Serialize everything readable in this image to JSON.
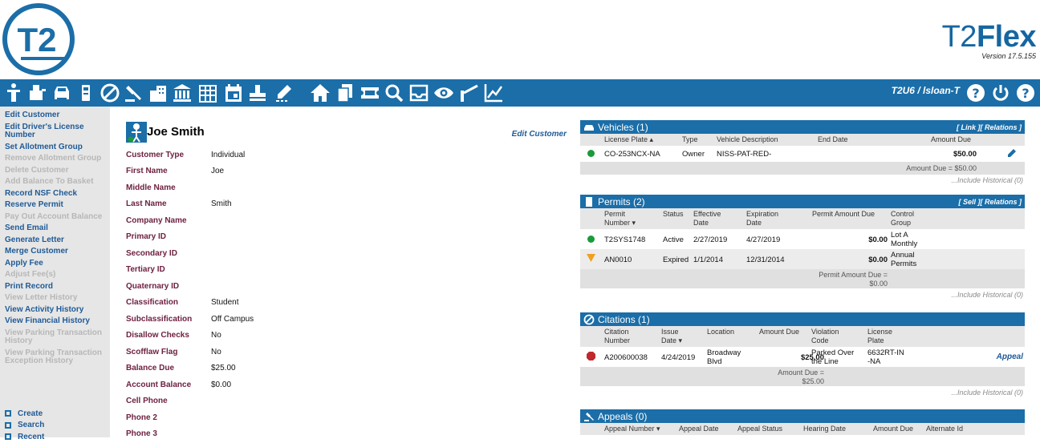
{
  "brand": {
    "name_light": "T2",
    "name_bold": "Flex",
    "version": "Version 17.5.155",
    "logo_text": "T2"
  },
  "toolbar": {
    "user": "T2U6 / lsloan-T",
    "icons": [
      "person-icon",
      "cart-icon",
      "car-icon",
      "permit-icon",
      "ban-icon",
      "gavel-icon",
      "buildings-icon",
      "bank-icon",
      "grid-building-icon",
      "calendar-icon",
      "stamp-icon",
      "pencil-icon",
      "home-icon",
      "copy-icon",
      "ticket-icon",
      "search-icon",
      "inbox-icon",
      "eye-icon",
      "gate-icon",
      "chart-icon"
    ],
    "right_icons": [
      "help-icon",
      "power-icon",
      "question-icon"
    ]
  },
  "sidebar": {
    "items": [
      {
        "label": "Edit Customer",
        "enabled": true
      },
      {
        "label": "Edit Driver's License Number",
        "enabled": true
      },
      {
        "label": "Set Allotment Group",
        "enabled": true
      },
      {
        "label": "Remove Allotment Group",
        "enabled": false
      },
      {
        "label": "Delete Customer",
        "enabled": false
      },
      {
        "label": "Add Balance To Basket",
        "enabled": false
      },
      {
        "label": "Record NSF Check",
        "enabled": true
      },
      {
        "label": "Reserve Permit",
        "enabled": true
      },
      {
        "label": "Pay Out Account Balance",
        "enabled": false
      },
      {
        "label": "Send Email",
        "enabled": true
      },
      {
        "label": "Generate Letter",
        "enabled": true
      },
      {
        "label": "Merge Customer",
        "enabled": true
      },
      {
        "label": "Apply Fee",
        "enabled": true
      },
      {
        "label": "Adjust Fee(s)",
        "enabled": false
      },
      {
        "label": "Print Record",
        "enabled": true
      },
      {
        "label": "View Letter History",
        "enabled": false
      },
      {
        "label": "View Activity History",
        "enabled": true
      },
      {
        "label": "View Financial History",
        "enabled": true
      },
      {
        "label": "View Parking Transaction History",
        "enabled": false
      },
      {
        "label": "View Parking Transaction Exception History",
        "enabled": false
      }
    ],
    "bottom": [
      "Create",
      "Search",
      "Recent"
    ]
  },
  "customer": {
    "name": "Joe Smith",
    "edit_label": "Edit Customer",
    "fields": [
      {
        "label": "Customer Type",
        "value": "Individual"
      },
      {
        "label": "First Name",
        "value": "Joe"
      },
      {
        "label": "Middle Name",
        "value": ""
      },
      {
        "label": "Last Name",
        "value": "Smith"
      },
      {
        "label": "Company Name",
        "value": ""
      },
      {
        "label": "Primary ID",
        "value": ""
      },
      {
        "label": "Secondary ID",
        "value": ""
      },
      {
        "label": "Tertiary ID",
        "value": ""
      },
      {
        "label": "Quaternary ID",
        "value": ""
      },
      {
        "label": "Classification",
        "value": "Student"
      },
      {
        "label": "Subclassification",
        "value": "Off Campus"
      },
      {
        "label": "Disallow Checks",
        "value": "No"
      },
      {
        "label": "Scofflaw Flag",
        "value": "No"
      },
      {
        "label": "Balance Due",
        "value": "$25.00"
      },
      {
        "label": "Account Balance",
        "value": "$0.00"
      },
      {
        "label": "Cell Phone",
        "value": ""
      },
      {
        "label": "Phone 2",
        "value": ""
      },
      {
        "label": "Phone 3",
        "value": ""
      }
    ]
  },
  "vehicles": {
    "title": "Vehicles (1)",
    "links": "[ Link ][ Relations ]",
    "headers": {
      "plate": "License Plate",
      "type": "Type",
      "desc": "Vehicle Description",
      "end": "End Date",
      "amount": "Amount Due"
    },
    "row": {
      "plate": "CO-253NCX-NA",
      "type": "Owner",
      "desc": "NISS-PAT-RED-",
      "end": "",
      "amount": "$50.00",
      "status_color": "#1a9a3a"
    },
    "summary": "Amount Due = $50.00",
    "historical": "...Include Historical (0)"
  },
  "permits": {
    "title": "Permits (2)",
    "links": "[ Sell ][ Relations ]",
    "headers": {
      "number": "Permit Number",
      "status": "Status",
      "effective": "Effective Date",
      "expiration": "Expiration Date",
      "amount": "Permit Amount Due",
      "group": "Control Group"
    },
    "rows": [
      {
        "number": "T2SYS1748",
        "status": "Active",
        "effective": "2/27/2019",
        "expiration": "4/27/2019",
        "amount": "$0.00",
        "group": "Lot A Monthly"
      },
      {
        "number": "AN0010",
        "status": "Expired",
        "effective": "1/1/2014",
        "expiration": "12/31/2014",
        "amount": "$0.00",
        "group": "Annual Permits"
      }
    ],
    "summary": "Permit Amount Due = $0.00",
    "historical": "...Include Historical (0)"
  },
  "citations": {
    "title": "Citations (1)",
    "headers": {
      "number": "Citation Number",
      "issue": "Issue Date",
      "location": "Location",
      "amount": "Amount Due",
      "violation": "Violation Code",
      "plate": "License Plate"
    },
    "row": {
      "number": "A200600038",
      "issue": "4/24/2019",
      "location": "Broadway Blvd",
      "amount": "$25.00",
      "violation": "Parked Over the Line",
      "plate": "6632RT-IN-NA",
      "action": "Appeal"
    },
    "summary": "Amount Due = $25.00",
    "historical": "...Include Historical (0)"
  },
  "appeals": {
    "title": "Appeals (0)",
    "headers": {
      "number": "Appeal Number",
      "date": "Appeal Date",
      "status": "Appeal Status",
      "hearing": "Hearing Date",
      "amount": "Amount Due",
      "alt": "Alternate Id"
    }
  }
}
